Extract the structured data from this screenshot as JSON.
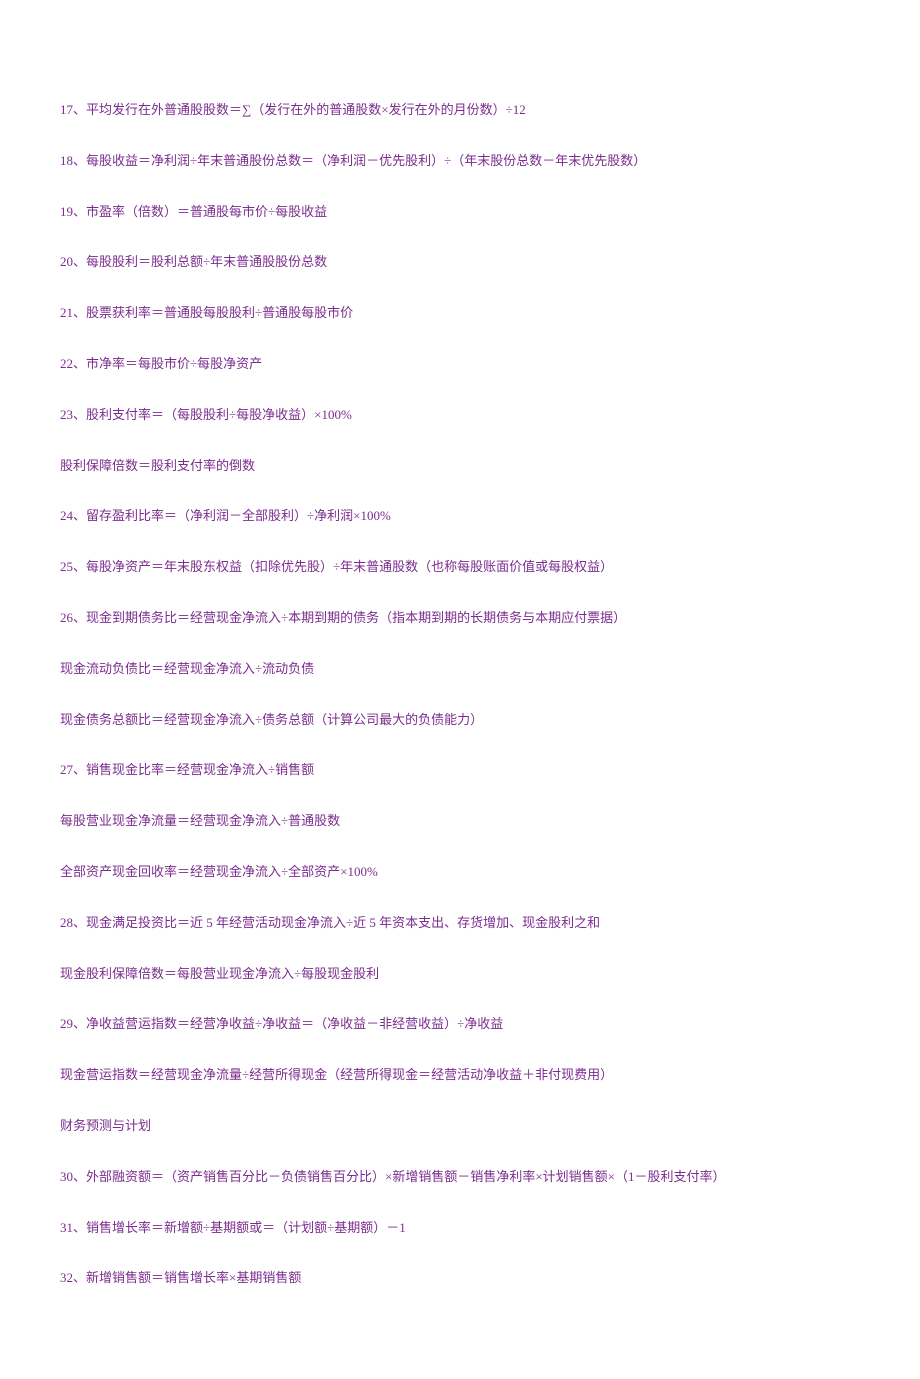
{
  "lines": [
    "17、平均发行在外普通股股数＝∑（发行在外的普通股数×发行在外的月份数）÷12",
    "18、每股收益＝净利润÷年末普通股份总数＝（净利润－优先股利）÷（年末股份总数－年末优先股数）",
    "19、市盈率（倍数）＝普通股每市价÷每股收益",
    "20、每股股利＝股利总额÷年末普通股股份总数",
    "21、股票获利率＝普通股每股股利÷普通股每股市价",
    "22、市净率＝每股市价÷每股净资产",
    "23、股利支付率＝（每股股利÷每股净收益）×100%",
    "股利保障倍数＝股利支付率的倒数",
    "24、留存盈利比率＝（净利润－全部股利）÷净利润×100%",
    "25、每股净资产＝年末股东权益（扣除优先股）÷年末普通股数（也称每股账面价值或每股权益）",
    "26、现金到期债务比＝经营现金净流入÷本期到期的债务（指本期到期的长期债务与本期应付票据）",
    "现金流动负债比＝经营现金净流入÷流动负债",
    "现金债务总额比＝经营现金净流入÷债务总额（计算公司最大的负债能力）",
    "27、销售现金比率＝经营现金净流入÷销售额",
    "每股营业现金净流量＝经营现金净流入÷普通股数",
    "全部资产现金回收率＝经营现金净流入÷全部资产×100%",
    "28、现金满足投资比＝近 5 年经营活动现金净流入÷近 5 年资本支出、存货增加、现金股利之和",
    "现金股利保障倍数＝每股营业现金净流入÷每股现金股利",
    "29、净收益营运指数＝经营净收益÷净收益＝（净收益－非经营收益）÷净收益",
    "现金营运指数＝经营现金净流量÷经营所得现金（经营所得现金＝经营活动净收益＋非付现费用）",
    "财务预测与计划",
    "30、外部融资额＝（资产销售百分比－负债销售百分比）×新增销售额－销售净利率×计划销售额×（1－股利支付率）",
    "31、销售增长率＝新增额÷基期额或＝（计划额÷基期额）－1",
    "32、新增销售额＝销售增长率×基期销售额"
  ]
}
